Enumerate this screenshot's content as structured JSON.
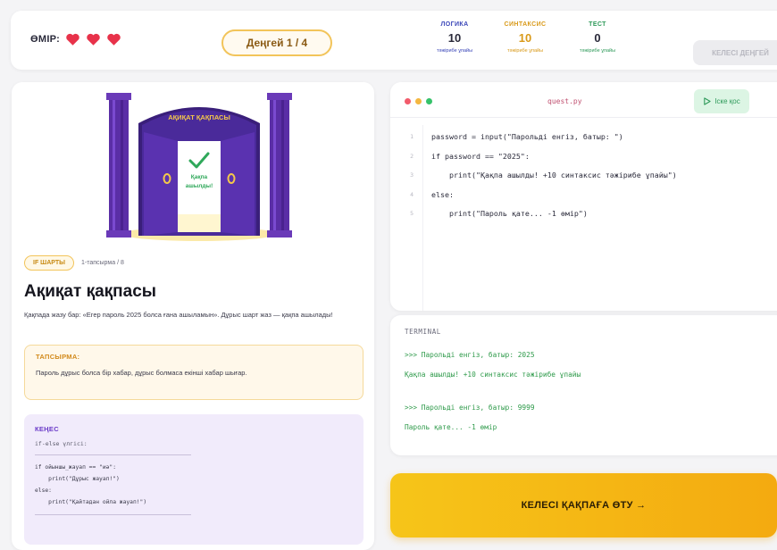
{
  "topbar": {
    "lives_label": "ӨМІР:",
    "lives": 3,
    "level": "Деңгей 1 / 4",
    "stats": {
      "logic": {
        "label": "ЛОГИКА",
        "value": "10",
        "sub": "тәжірибе ұпайы"
      },
      "syntax": {
        "label": "СИНТАКСИС",
        "value": "10",
        "sub": "тәжірибе ұпайы"
      },
      "test": {
        "label": "ТЕСТ",
        "value": "0",
        "sub": "тәжірибе ұпайы"
      }
    },
    "top_button": "КЕЛЕСІ ДЕҢГЕЙ"
  },
  "scene": {
    "gate_label": "АҚИҚАТ ҚАҚПАСЫ",
    "gate_status": "Қақпа ашылды!",
    "colors": {
      "pillar": "#5a2ea6",
      "gate": "#4a2a9a",
      "accent": "#f4c84a",
      "check": "#2fa85a"
    }
  },
  "quest": {
    "tag": "IF ШАРТЫ",
    "meta": "1-тапсырма / 8",
    "title": "Ақиқат қақпасы",
    "description": "Қақпада жазу бар: «Егер пароль 2025 болса ғана ашыламын». Дұрыс шарт жаз — қақпа ашылады!",
    "task_label": "ТАПСЫРМА:",
    "task_text": "Пароль дұрыс болса бір хабар, дұрыс болмаса екінші хабар шығар.",
    "hint_label": "КЕҢЕС",
    "hint_sub": "if-else үлгісі:",
    "hint_code": "if ойыншы_жауап == \"иә\":\n    print(\"Дұрыс жауап!\")\nelse:\n    print(\"Қайтадан ойла жауап!\")"
  },
  "editor": {
    "file_name": "quest.py",
    "run_label": "Іске қос",
    "lines": [
      {
        "n": "1",
        "text": "password = input(\"Парольді енгіз, батыр: \")"
      },
      {
        "n": "2",
        "text": "if password == \"2025\":"
      },
      {
        "n": "3",
        "text": "    print(\"Қақпа ашылды! +10 синтаксис тәжірибе ұпайы\")"
      },
      {
        "n": "4",
        "text": "else:"
      },
      {
        "n": "5",
        "text": "    print(\"Пароль қате... -1 өмір\")"
      }
    ]
  },
  "terminal": {
    "label": "TERMINAL",
    "lines": [
      ">>> Парольді енгіз, батыр: 2025",
      "Қақпа ашылды! +10 синтаксис тәжірибе ұпайы",
      ">>> Парольді енгіз, батыр: 9999",
      "Пароль қате... -1 өмір"
    ]
  },
  "next_button": "КЕЛЕСІ ҚАҚПАҒА ӨТУ →"
}
